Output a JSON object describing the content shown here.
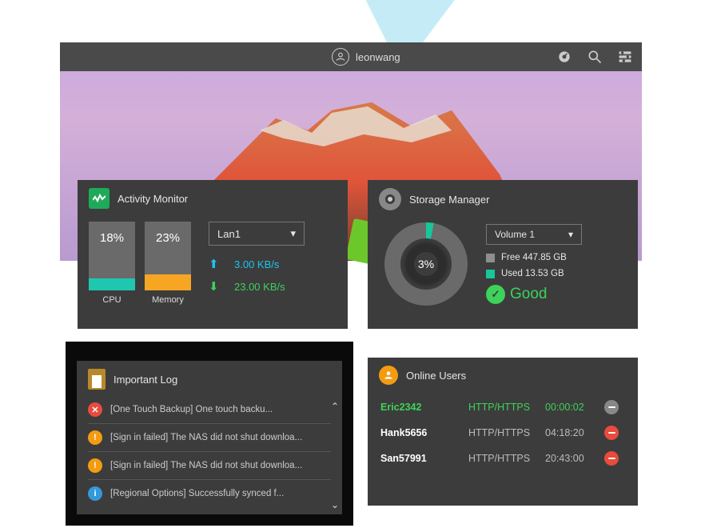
{
  "header": {
    "username": "leonwang"
  },
  "activity": {
    "title": "Activity Monitor",
    "cpu": {
      "label": "CPU",
      "percent": "18%",
      "value": 18,
      "color": "#1fc7b0"
    },
    "memory": {
      "label": "Memory",
      "percent": "23%",
      "value": 23,
      "color": "#f6a623"
    },
    "lan_selected": "Lan1",
    "upload": "3.00 KB/s",
    "download": "23.00 KB/s"
  },
  "storage": {
    "title": "Storage Manager",
    "volume_selected": "Volume 1",
    "used_pct_label": "3%",
    "used_pct": 3,
    "free": {
      "label": "Free 447.85 GB",
      "color": "#8e8e8e"
    },
    "used": {
      "label": "Used 13.53 GB",
      "color": "#16c79a"
    },
    "status": "Good"
  },
  "log": {
    "title": "Important Log",
    "items": [
      {
        "type": "error",
        "text": "[One Touch Backup] One touch backu..."
      },
      {
        "type": "warn",
        "text": "[Sign in failed] The NAS did not shut downloa..."
      },
      {
        "type": "warn",
        "text": "[Sign in failed] The NAS did not shut downloa..."
      },
      {
        "type": "info",
        "text": "[Regional Options] Successfully synced f..."
      }
    ]
  },
  "online": {
    "title": "Online Users",
    "rows": [
      {
        "name": "Eric2342",
        "proto": "HTTP/HTTPS",
        "time": "00:00:02",
        "online": true,
        "dot": "gray"
      },
      {
        "name": "Hank5656",
        "proto": "HTTP/HTTPS",
        "time": "04:18:20",
        "online": false,
        "dot": "red"
      },
      {
        "name": "San57991",
        "proto": "HTTP/HTTPS",
        "time": "20:43:00",
        "online": false,
        "dot": "red"
      }
    ]
  }
}
